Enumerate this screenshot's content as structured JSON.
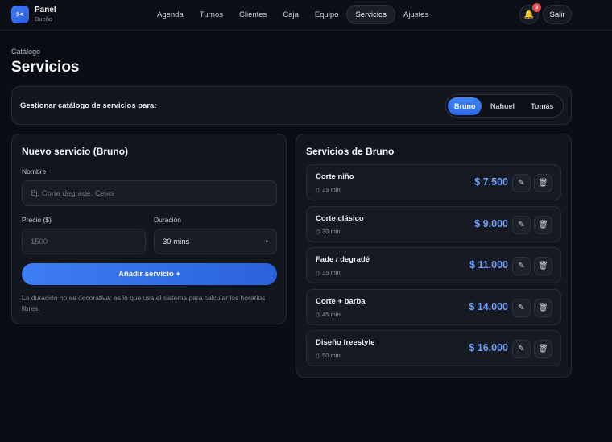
{
  "header": {
    "brand_title": "Panel",
    "brand_subtitle": "Dueño",
    "brand_icon": "scissors-icon",
    "nav": [
      {
        "label": "Agenda",
        "active": false
      },
      {
        "label": "Turnos",
        "active": false
      },
      {
        "label": "Clientes",
        "active": false
      },
      {
        "label": "Caja",
        "active": false
      },
      {
        "label": "Equipo",
        "active": false
      },
      {
        "label": "Servicios",
        "active": true
      },
      {
        "label": "Ajustes",
        "active": false
      }
    ],
    "notification_count": "3",
    "logout_label": "Salir"
  },
  "page": {
    "breadcrumb": "Catálogo",
    "title": "Servicios"
  },
  "selector": {
    "label": "Gestionar catálogo de servicios para:",
    "options": [
      "Bruno",
      "Nahuel",
      "Tomás"
    ],
    "selected": "Bruno"
  },
  "form": {
    "title": "Nuevo servicio (Bruno)",
    "name_label": "Nombre",
    "name_placeholder": "Ej. Corte degradé, Cejas",
    "price_label": "Precio ($)",
    "price_placeholder": "1500",
    "duration_label": "Duración",
    "duration_value": "30 mins",
    "add_button": "Añadir servicio +",
    "hint": "La duración no es decorativa: es lo que usa el sistema para calcular los horarios libres."
  },
  "list": {
    "title": "Servicios de Bruno",
    "items": [
      {
        "name": "Corte niño",
        "duration": "25 min",
        "price": "$ 7.500"
      },
      {
        "name": "Corte clásico",
        "duration": "30 min",
        "price": "$ 9.000"
      },
      {
        "name": "Fade / degradé",
        "duration": "35 min",
        "price": "$ 11.000"
      },
      {
        "name": "Corte + barba",
        "duration": "45 min",
        "price": "$ 14.000"
      },
      {
        "name": "Diseño freestyle",
        "duration": "50 min",
        "price": "$ 16.000"
      }
    ]
  },
  "colors": {
    "accent": "#3d7df5",
    "price": "#6f9cf6",
    "badge": "#e5484d",
    "background": "#0a0d13"
  }
}
